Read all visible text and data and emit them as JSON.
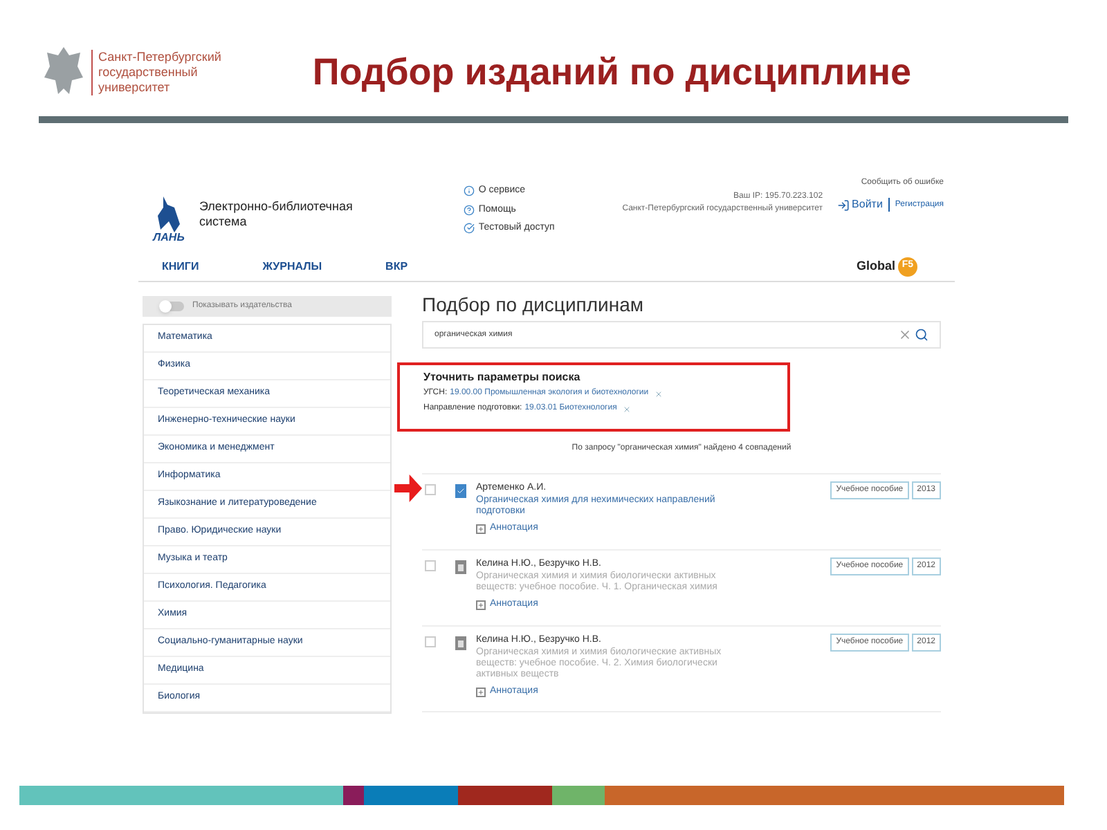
{
  "slide": {
    "org_lines": [
      "Санкт-Петербургский",
      "государственный",
      "университет"
    ],
    "title": "Подбор изданий по дисциплине"
  },
  "site": {
    "brand": "ЛАНЬ",
    "name_lines": [
      "Электронно-библиотечная",
      "система"
    ],
    "info_links": [
      {
        "kind": "info",
        "label": "О сервисе"
      },
      {
        "kind": "help",
        "label": "Помощь"
      },
      {
        "kind": "check",
        "label": "Тестовый доступ"
      }
    ],
    "report_link": "Сообщить об ошибке",
    "ip": "Ваш IP: 195.70.223.102",
    "org": "Санкт-Петербургский государственный университет",
    "login": "Войти",
    "register": "Регистрация",
    "nav": [
      "КНИГИ",
      "ЖУРНАЛЫ",
      "ВКР"
    ],
    "partner": {
      "label": "Global",
      "badge": "F5"
    }
  },
  "sidebar": {
    "toggle": {
      "label": "Показывать издательства",
      "on": false
    },
    "items": [
      "Математика",
      "Физика",
      "Теоретическая механика",
      "Инженерно-технические науки",
      "Экономика и менеджмент",
      "Информатика",
      "Языкознание и литературоведение",
      "Право. Юридические науки",
      "Музыка и театр",
      "Психология. Педагогика",
      "Химия",
      "Социально-гуманитарные науки",
      "Медицина",
      "Биология"
    ]
  },
  "main": {
    "title": "Подбор по дисциплинам",
    "search": {
      "value": "органическая химия"
    },
    "refine": {
      "title": "Уточнить параметры поиска",
      "filters": [
        {
          "name": "УГСН:",
          "value": "19.00.00 Промышленная экология и биотехнологии"
        },
        {
          "name": "Направление подготовки:",
          "value": "19.03.01 Биотехнология"
        }
      ]
    },
    "summary": "По запросу \"органическая химия\" найдено 4 совпадений",
    "results": [
      {
        "checked": false,
        "available": true,
        "authors": "Артеменко А.И.",
        "title": "Органическая химия для нехимических направлений подготовки",
        "annotation": "Аннотация",
        "type": "Учебное пособие",
        "year": "2013"
      },
      {
        "checked": false,
        "available": false,
        "authors": "Келина Н.Ю., Безручко Н.В.",
        "title": "Органическая химия и химия биологически активных веществ: учебное пособие. Ч. 1. Органическая химия",
        "annotation": "Аннотация",
        "type": "Учебное пособие",
        "year": "2012"
      },
      {
        "checked": false,
        "available": false,
        "authors": "Келина Н.Ю., Безручко Н.В.",
        "title": "Органическая химия и химия биологические активных веществ: учебное пособие. Ч. 2. Химия биологически активных веществ",
        "annotation": "Аннотация",
        "type": "Учебное пособие",
        "year": "2012"
      }
    ]
  },
  "footer_bar": [
    {
      "color": "#62c3bb"
    },
    {
      "color": "#8a1c5a"
    },
    {
      "color": "#0a7db8"
    },
    {
      "color": "#a0281e"
    },
    {
      "color": "#6fb469"
    },
    {
      "color": "#c8662a"
    }
  ]
}
